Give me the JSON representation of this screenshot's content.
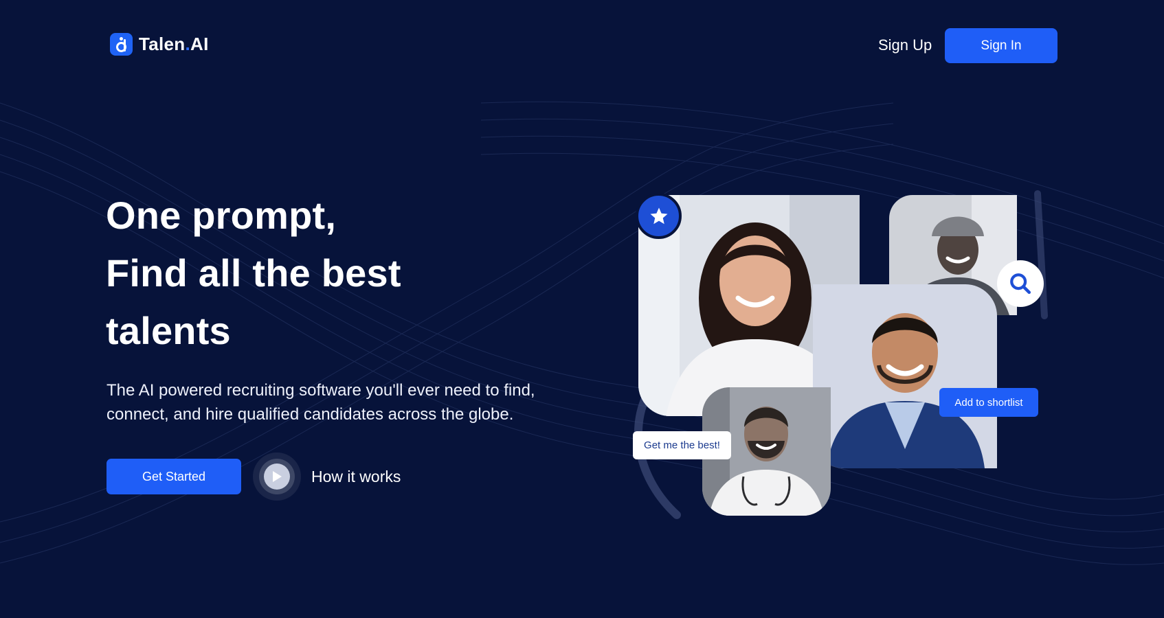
{
  "colors": {
    "background": "#07133a",
    "accent": "#1f5ef7",
    "text": "#ffffff",
    "chip_text": "#1b3a8e"
  },
  "header": {
    "logo_name": "Talen",
    "logo_separator": ".",
    "logo_suffix": "AI",
    "sign_up_label": "Sign Up",
    "sign_in_label": "Sign In"
  },
  "hero": {
    "title_lines": [
      "One prompt,",
      "Find all the best",
      "talents"
    ],
    "subtitle_lines": [
      "The AI powered recruiting software you'll ever need to find,",
      "connect, and hire qualified candidates across the globe."
    ],
    "get_started_label": "Get Started",
    "how_it_works_label": "How it works"
  },
  "collage": {
    "add_to_shortlist_label": "Add to shortlist",
    "get_me_the_best_label": "Get me the best!",
    "icons": [
      "star-icon",
      "search-icon",
      "play-icon"
    ]
  }
}
